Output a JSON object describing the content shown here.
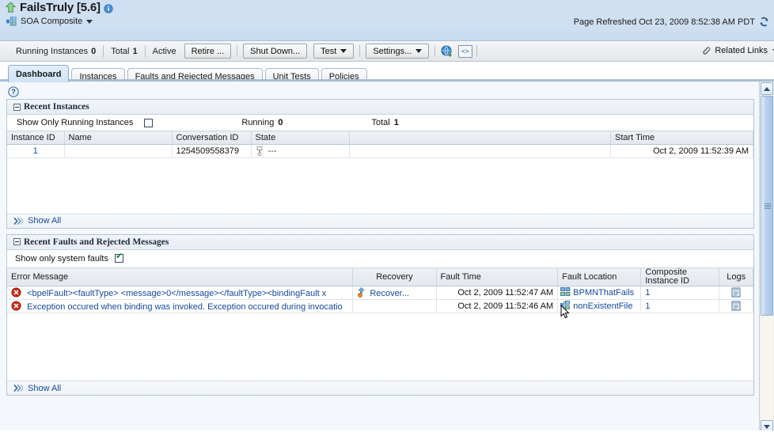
{
  "header": {
    "title": "FailsTruly [5.6]",
    "up_arrow_icon": "up-arrow-icon",
    "info_icon": "info-icon",
    "composite_icon": "soa-composite-icon",
    "subtitle": "SOA Composite",
    "refresh_text": "Page Refreshed Oct 23, 2009 8:52:38 AM PDT",
    "refresh_icon": "refresh-icon"
  },
  "toolbar": {
    "running_instances_label": "Running Instances",
    "running_instances_value": "0",
    "total_label": "Total",
    "total_value": "1",
    "active_label": "Active",
    "retire_button": "Retire ...",
    "shutdown_button": "Shut Down...",
    "test_button": "Test",
    "settings_button": "Settings...",
    "wsdl_icon": "globe-arrow-icon",
    "code_icon": "angle-brackets-icon",
    "related_links_label": "Related Links",
    "paperclip_icon": "paperclip-icon"
  },
  "tabs": [
    {
      "label": "Dashboard",
      "active": true
    },
    {
      "label": "Instances",
      "active": false
    },
    {
      "label": "Faults and Rejected Messages",
      "active": false
    },
    {
      "label": "Unit Tests",
      "active": false
    },
    {
      "label": "Policies",
      "active": false
    }
  ],
  "help_icon": "help-question-icon",
  "recent_instances": {
    "panel_title": "Recent Instances",
    "show_only_running_label": "Show Only Running Instances",
    "show_only_running_checked": false,
    "running_label": "Running",
    "running_value": "0",
    "total_label": "Total",
    "total_value": "1",
    "columns": [
      "Instance ID",
      "Name",
      "Conversation ID",
      "State",
      "",
      "Start Time"
    ],
    "rows": [
      {
        "instance_id": "1",
        "name": "",
        "conversation_id": "1254509558379",
        "state_icon": "state-unknown-icon",
        "state": "---",
        "start_time": "Oct 2, 2009 11:52:39 AM"
      }
    ],
    "show_all_label": "Show All",
    "show_all_icon": "double-chevron-icon"
  },
  "recent_faults": {
    "panel_title": "Recent Faults and Rejected Messages",
    "show_only_system_faults_label": "Show only system faults",
    "show_only_system_faults_checked": true,
    "columns": [
      "Error Message",
      "Recovery",
      "Fault Time",
      "Fault Location",
      "Composite Instance ID",
      "Logs"
    ],
    "rows": [
      {
        "error_icon": "error-circle-icon",
        "error_message": "<bpelFault><faultType> <message>0</message></faultType><bindingFault x",
        "recovery_icon": "recover-icon",
        "recovery": "Recover...",
        "fault_time": "Oct 2, 2009 11:52:47 AM",
        "location_icon": "bpmn-component-icon",
        "fault_location": "BPMNThatFails",
        "composite_instance_id": "1",
        "logs_icon": "logs-icon"
      },
      {
        "error_icon": "error-circle-icon",
        "error_message": "Exception occured when binding was invoked. Exception occured during invocatio",
        "recovery_icon": "",
        "recovery": "",
        "fault_time": "Oct 2, 2009 11:52:46 AM",
        "location_icon": "adapter-component-icon",
        "fault_location": "nonExistentFile",
        "composite_instance_id": "1",
        "logs_icon": "logs-icon"
      }
    ],
    "show_all_label": "Show All",
    "show_all_icon": "double-chevron-icon"
  },
  "scrollbar": {
    "up_icon": "chevron-up-icon",
    "down_icon": "chevron-down-icon"
  },
  "colors": {
    "header_bg": "#cddff1",
    "link": "#15479e",
    "error": "#d42b16",
    "check": "#0f8a2e",
    "accent": "#a9c3dc"
  }
}
